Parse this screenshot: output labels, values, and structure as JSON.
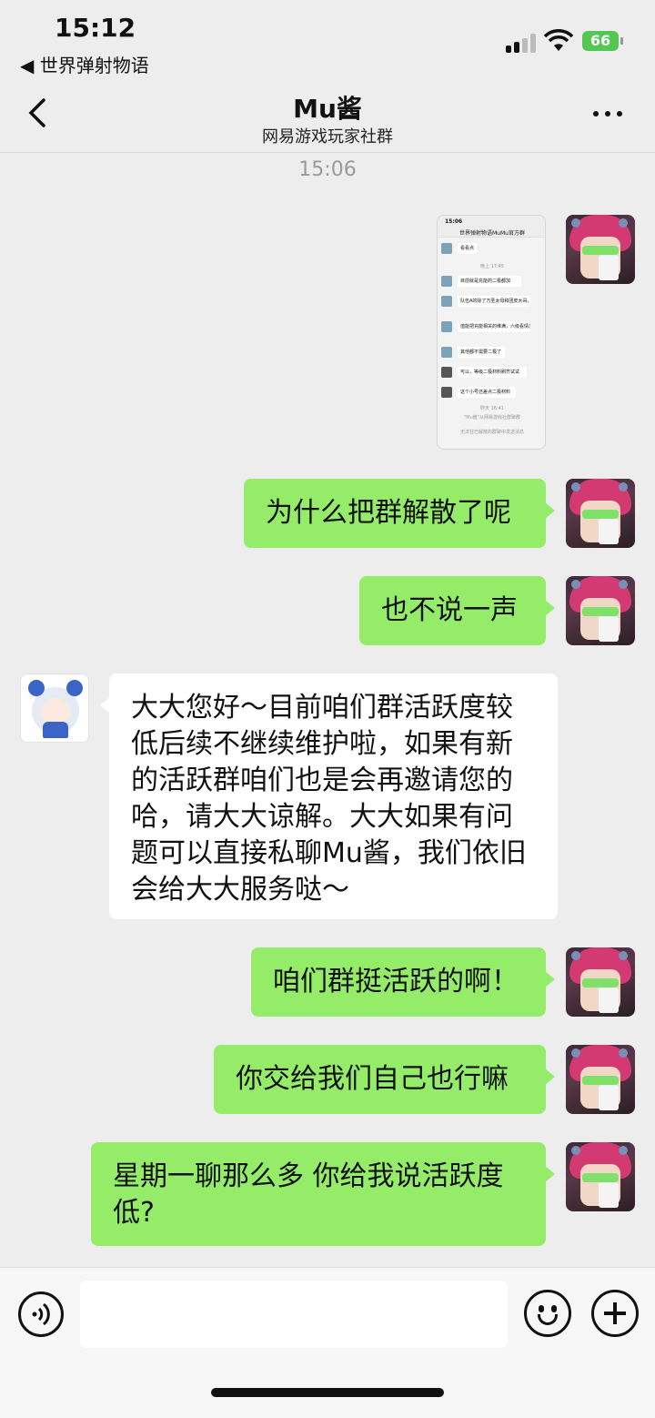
{
  "status_bar": {
    "time": "15:12",
    "back_app": "◀ 世界弹射物语",
    "battery": "66"
  },
  "nav": {
    "title": "Mu酱",
    "subtitle": "网易游戏玩家社群"
  },
  "time_separator": "15:06",
  "screenshot_thumb": {
    "time": "15:06",
    "title": "世界弹射物语MuMu官方群",
    "rows": [
      "看看点",
      "目前就是充能的二极都加",
      "队伍A的除了万圣太母和团皮大哥，其他都基本全二极",
      "值能把充能相关的维满，六级看情况开",
      "其他都不需要二极了",
      "可以，等级二极材料刷齐试试",
      "这个小号还差点二极材料"
    ],
    "notes": [
      "晚上 17:45",
      "昨天 16:41",
      "\"Mu酱\"从网易游戏社群聊群",
      "无法在已解散的群聊中发送消息"
    ]
  },
  "messages": [
    {
      "side": "me",
      "text": "为什么把群解散了呢"
    },
    {
      "side": "me",
      "text": "也不说一声"
    },
    {
      "side": "other",
      "text": "大大您好～目前咱们群活跃度较低后续不继续维护啦，如果有新的活跃群咱们也是会再邀请您的哈，请大大谅解。大大如果有问题可以直接私聊Mu酱，我们依旧会给大大服务哒～"
    },
    {
      "side": "me",
      "text": "咱们群挺活跃的啊！"
    },
    {
      "side": "me",
      "text": "你交给我们自己也行嘛"
    },
    {
      "side": "me",
      "text": "星期一聊那么多 你给我说活跃度低?"
    }
  ],
  "input": {
    "placeholder": ""
  },
  "colors": {
    "my_bubble": "#95ec69",
    "other_bubble": "#ffffff",
    "background": "#ededed"
  }
}
